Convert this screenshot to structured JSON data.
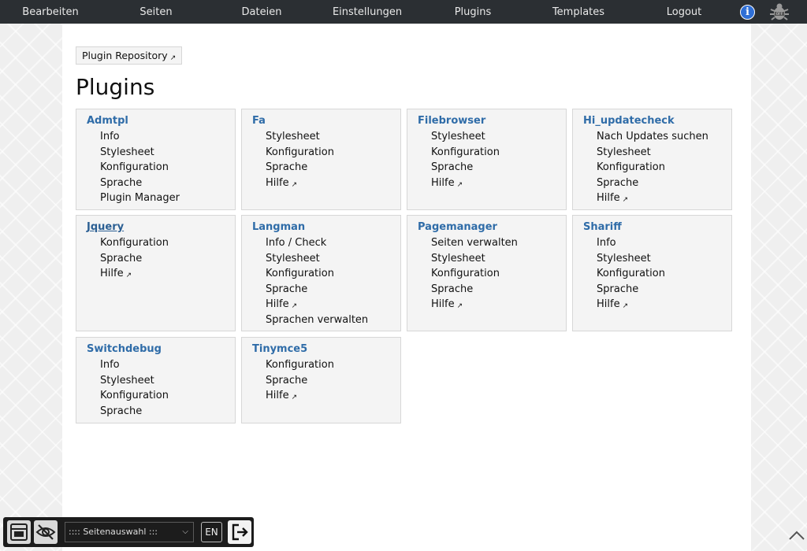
{
  "topbar": {
    "items": [
      "Bearbeiten",
      "Seiten",
      "Dateien",
      "Einstellungen",
      "Plugins",
      "Templates",
      "Logout"
    ],
    "info_icon_glyph": "i",
    "info_icon": "info-icon",
    "debug_icon": "debug-bug-icon",
    "background": "#2b2f33"
  },
  "repo_button": {
    "label": "Plugin Repository",
    "icon": "external-link-icon"
  },
  "page_title": "Plugins",
  "plugins": [
    {
      "name": "Admtpl",
      "links": [
        "Info",
        "Stylesheet",
        "Konfiguration",
        "Sprache",
        "Plugin Manager"
      ]
    },
    {
      "name": "Fa",
      "links": [
        "Stylesheet",
        "Konfiguration",
        "Sprache",
        "Hilfe"
      ]
    },
    {
      "name": "Filebrowser",
      "links": [
        "Stylesheet",
        "Konfiguration",
        "Sprache",
        "Hilfe"
      ]
    },
    {
      "name": "Hi_updatecheck",
      "links": [
        "Nach Updates suchen",
        "Stylesheet",
        "Konfiguration",
        "Sprache",
        "Hilfe"
      ]
    },
    {
      "name": "Jquery",
      "links": [
        "Konfiguration",
        "Sprache",
        "Hilfe"
      ]
    },
    {
      "name": "Langman",
      "links": [
        "Info / Check",
        "Stylesheet",
        "Konfiguration",
        "Sprache",
        "Hilfe",
        "Sprachen verwalten"
      ]
    },
    {
      "name": "Pagemanager",
      "links": [
        "Seiten verwalten",
        "Stylesheet",
        "Konfiguration",
        "Sprache",
        "Hilfe"
      ]
    },
    {
      "name": "Shariff",
      "links": [
        "Info",
        "Stylesheet",
        "Konfiguration",
        "Sprache",
        "Hilfe"
      ]
    },
    {
      "name": "Switchdebug",
      "links": [
        "Info",
        "Stylesheet",
        "Konfiguration",
        "Sprache"
      ]
    },
    {
      "name": "Tinymce5",
      "links": [
        "Konfiguration",
        "Sprache",
        "Hilfe"
      ]
    }
  ],
  "external_link_label": "Hilfe",
  "toolbar": {
    "page_select": ":::: Seitenauswahl :::",
    "language": "EN",
    "icons": [
      "admin-panel-icon",
      "hide-eye-icon",
      "chevron-down-icon",
      "logout-icon"
    ]
  },
  "scroll_top_icon": "chevron-up-icon"
}
